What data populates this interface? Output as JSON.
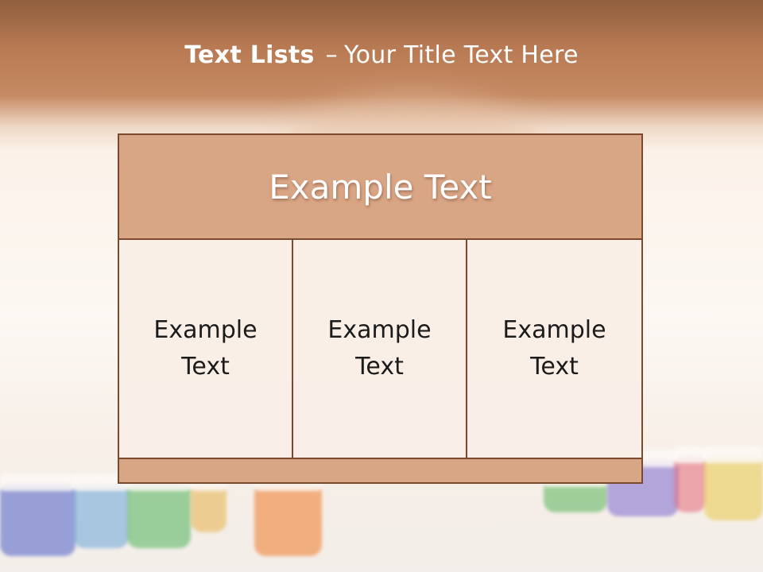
{
  "title": {
    "bold": "Text Lists",
    "dash": "–",
    "rest": "Your Title Text Here"
  },
  "table": {
    "header": "Example Text",
    "columns": [
      "Example\nText",
      "Example\nText",
      "Example\nText"
    ]
  },
  "colors": {
    "header_band": "#b87a53",
    "cell_header": "#d8a585",
    "border": "#7a4a2e"
  }
}
